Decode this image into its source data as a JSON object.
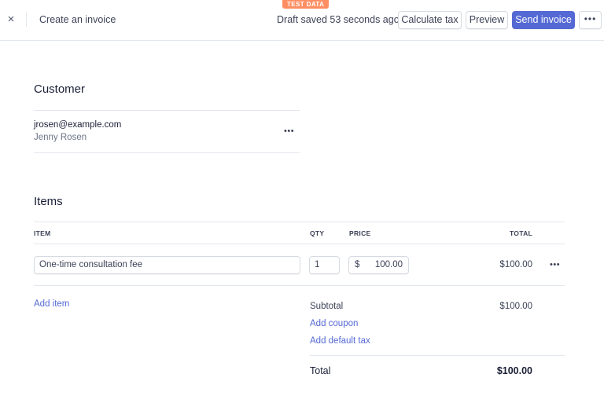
{
  "header": {
    "title": "Create an invoice",
    "test_badge": "TEST DATA",
    "draft_status": "Draft saved 53 seconds ago",
    "buttons": {
      "calculate_tax": "Calculate tax",
      "preview": "Preview",
      "send_invoice": "Send invoice",
      "more": "•••"
    },
    "close_icon": "×"
  },
  "customer": {
    "section_title": "Customer",
    "email": "jrosen@example.com",
    "name": "Jenny Rosen",
    "menu": "•••"
  },
  "items": {
    "section_title": "Items",
    "columns": {
      "item": "ITEM",
      "qty": "QTY",
      "price": "PRICE",
      "total": "TOTAL"
    },
    "rows": [
      {
        "description": "One-time consultation fee",
        "qty": "1",
        "currency": "$",
        "price": "100.00",
        "total": "$100.00",
        "menu": "•••"
      }
    ],
    "add_item": "Add item"
  },
  "summary": {
    "subtotal_label": "Subtotal",
    "subtotal_value": "$100.00",
    "add_coupon": "Add coupon",
    "add_default_tax": "Add default tax",
    "total_label": "Total",
    "total_value": "$100.00"
  },
  "colors": {
    "primary": "#5469d4",
    "badge": "#ff8f63",
    "border": "#e3e8ee"
  }
}
